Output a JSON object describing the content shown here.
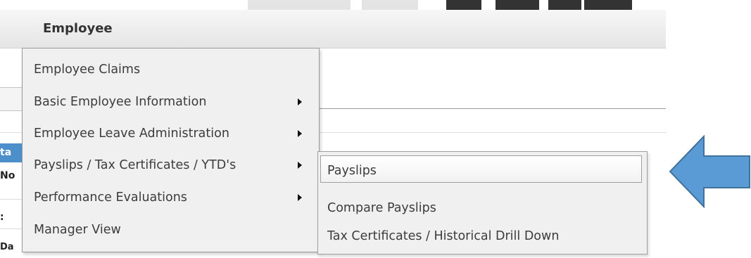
{
  "header": {
    "title": "Employee"
  },
  "background": {
    "cells": [
      "ta",
      "No",
      ":",
      "Da"
    ]
  },
  "menu": {
    "items": [
      {
        "label": "Employee Claims",
        "has_submenu": false
      },
      {
        "label": "Basic Employee Information",
        "has_submenu": true
      },
      {
        "label": "Employee Leave Administration",
        "has_submenu": true
      },
      {
        "label": "Payslips / Tax Certificates / YTD's",
        "has_submenu": true
      },
      {
        "label": "Performance Evaluations",
        "has_submenu": true
      },
      {
        "label": "Manager View",
        "has_submenu": false
      }
    ]
  },
  "submenu": {
    "items": [
      {
        "label": "Payslips",
        "active": true
      },
      {
        "label": "Compare Payslips",
        "active": false
      },
      {
        "label": "Tax Certificates / Historical Drill Down",
        "active": false
      }
    ]
  },
  "colors": {
    "menu_bg": "#f0f0f0",
    "highlight_blue": "#4d8fcb",
    "callout_arrow": "#5b9bd5",
    "callout_arrow_border": "#41719c"
  },
  "icons": [
    "submenu-arrow-icon",
    "callout-arrow-icon"
  ]
}
